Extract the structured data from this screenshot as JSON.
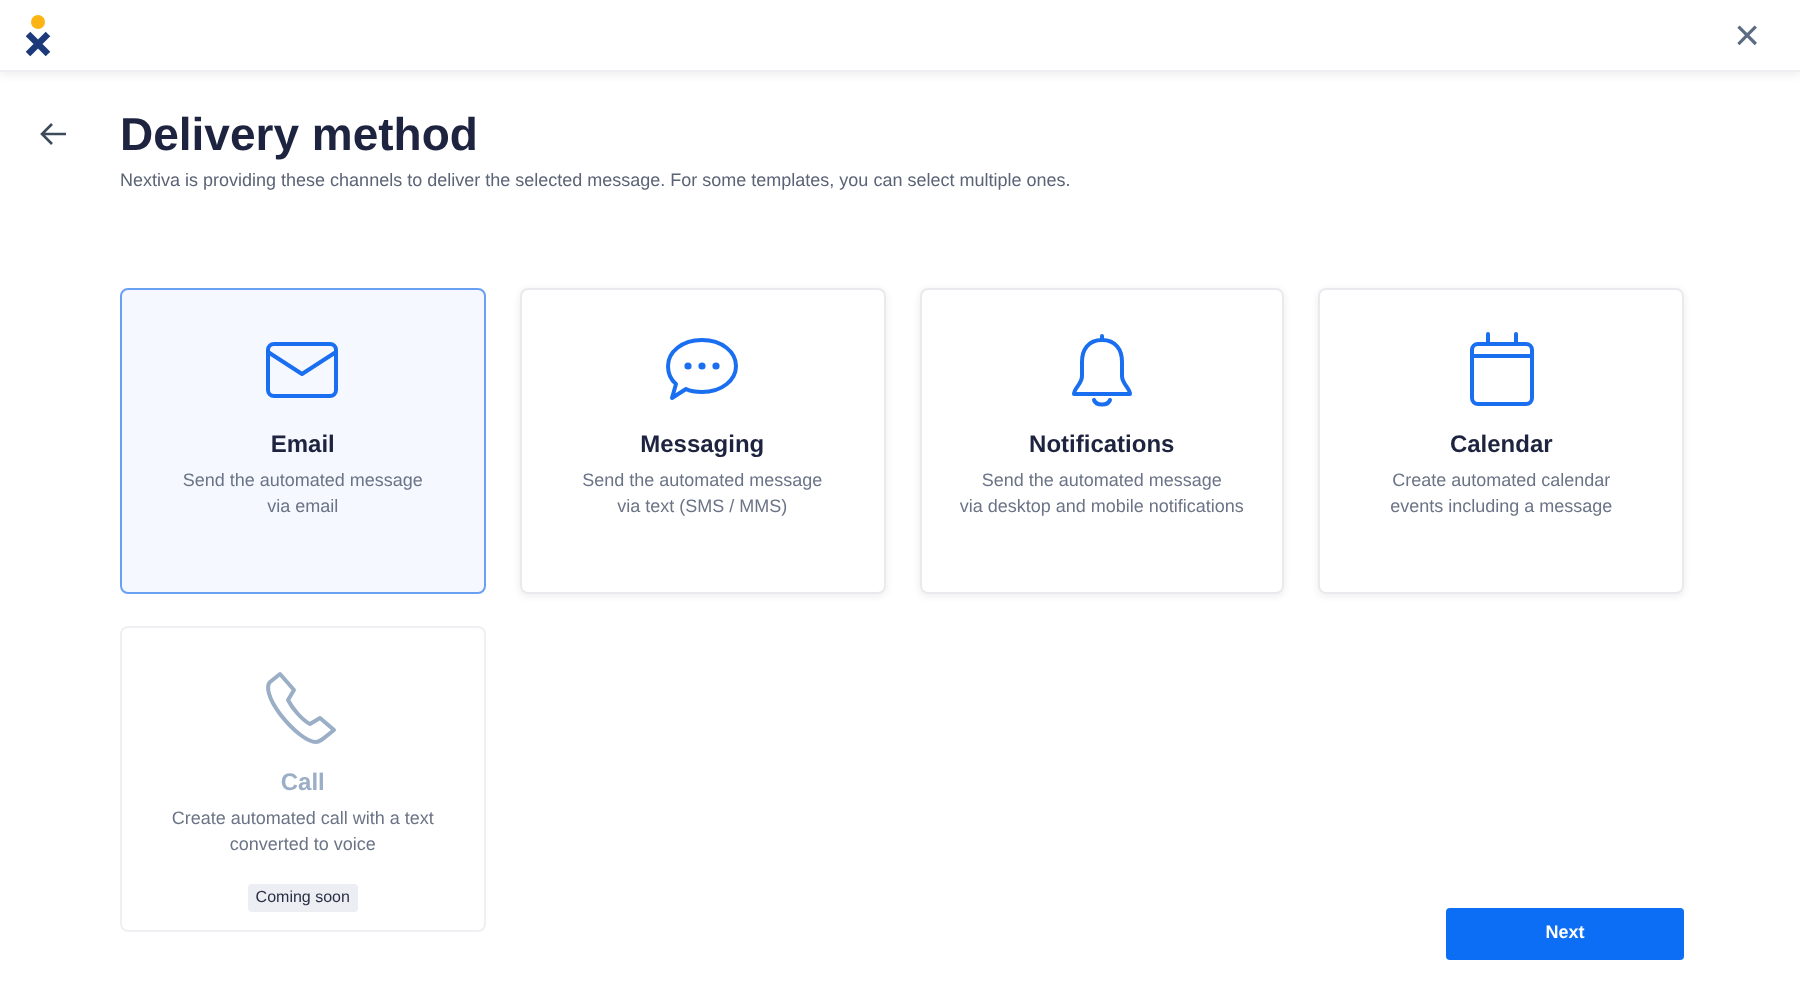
{
  "header": {
    "close": "×"
  },
  "title": "Delivery method",
  "subtitle": "Nextiva is providing these channels to deliver the selected message. For some templates, you can select multiple ones.",
  "channels": [
    {
      "kind": "email",
      "name": "Email",
      "description": "Send the automated message\nvia email",
      "selected": true,
      "disabled": false
    },
    {
      "kind": "messaging",
      "name": "Messaging",
      "description": "Send the automated message\nvia text (SMS / MMS)",
      "selected": false,
      "disabled": false
    },
    {
      "kind": "notifications",
      "name": "Notifications",
      "description": "Send the automated message\nvia desktop and mobile notifications",
      "selected": false,
      "disabled": false
    },
    {
      "kind": "calendar",
      "name": "Calendar",
      "description": "Create automated calendar\nevents including a message",
      "selected": false,
      "disabled": false
    },
    {
      "kind": "call",
      "name": "Call",
      "description": "Create automated call with a text\nconverted to voice",
      "selected": false,
      "disabled": true,
      "badge": "Coming soon"
    }
  ],
  "next_button": "Next"
}
